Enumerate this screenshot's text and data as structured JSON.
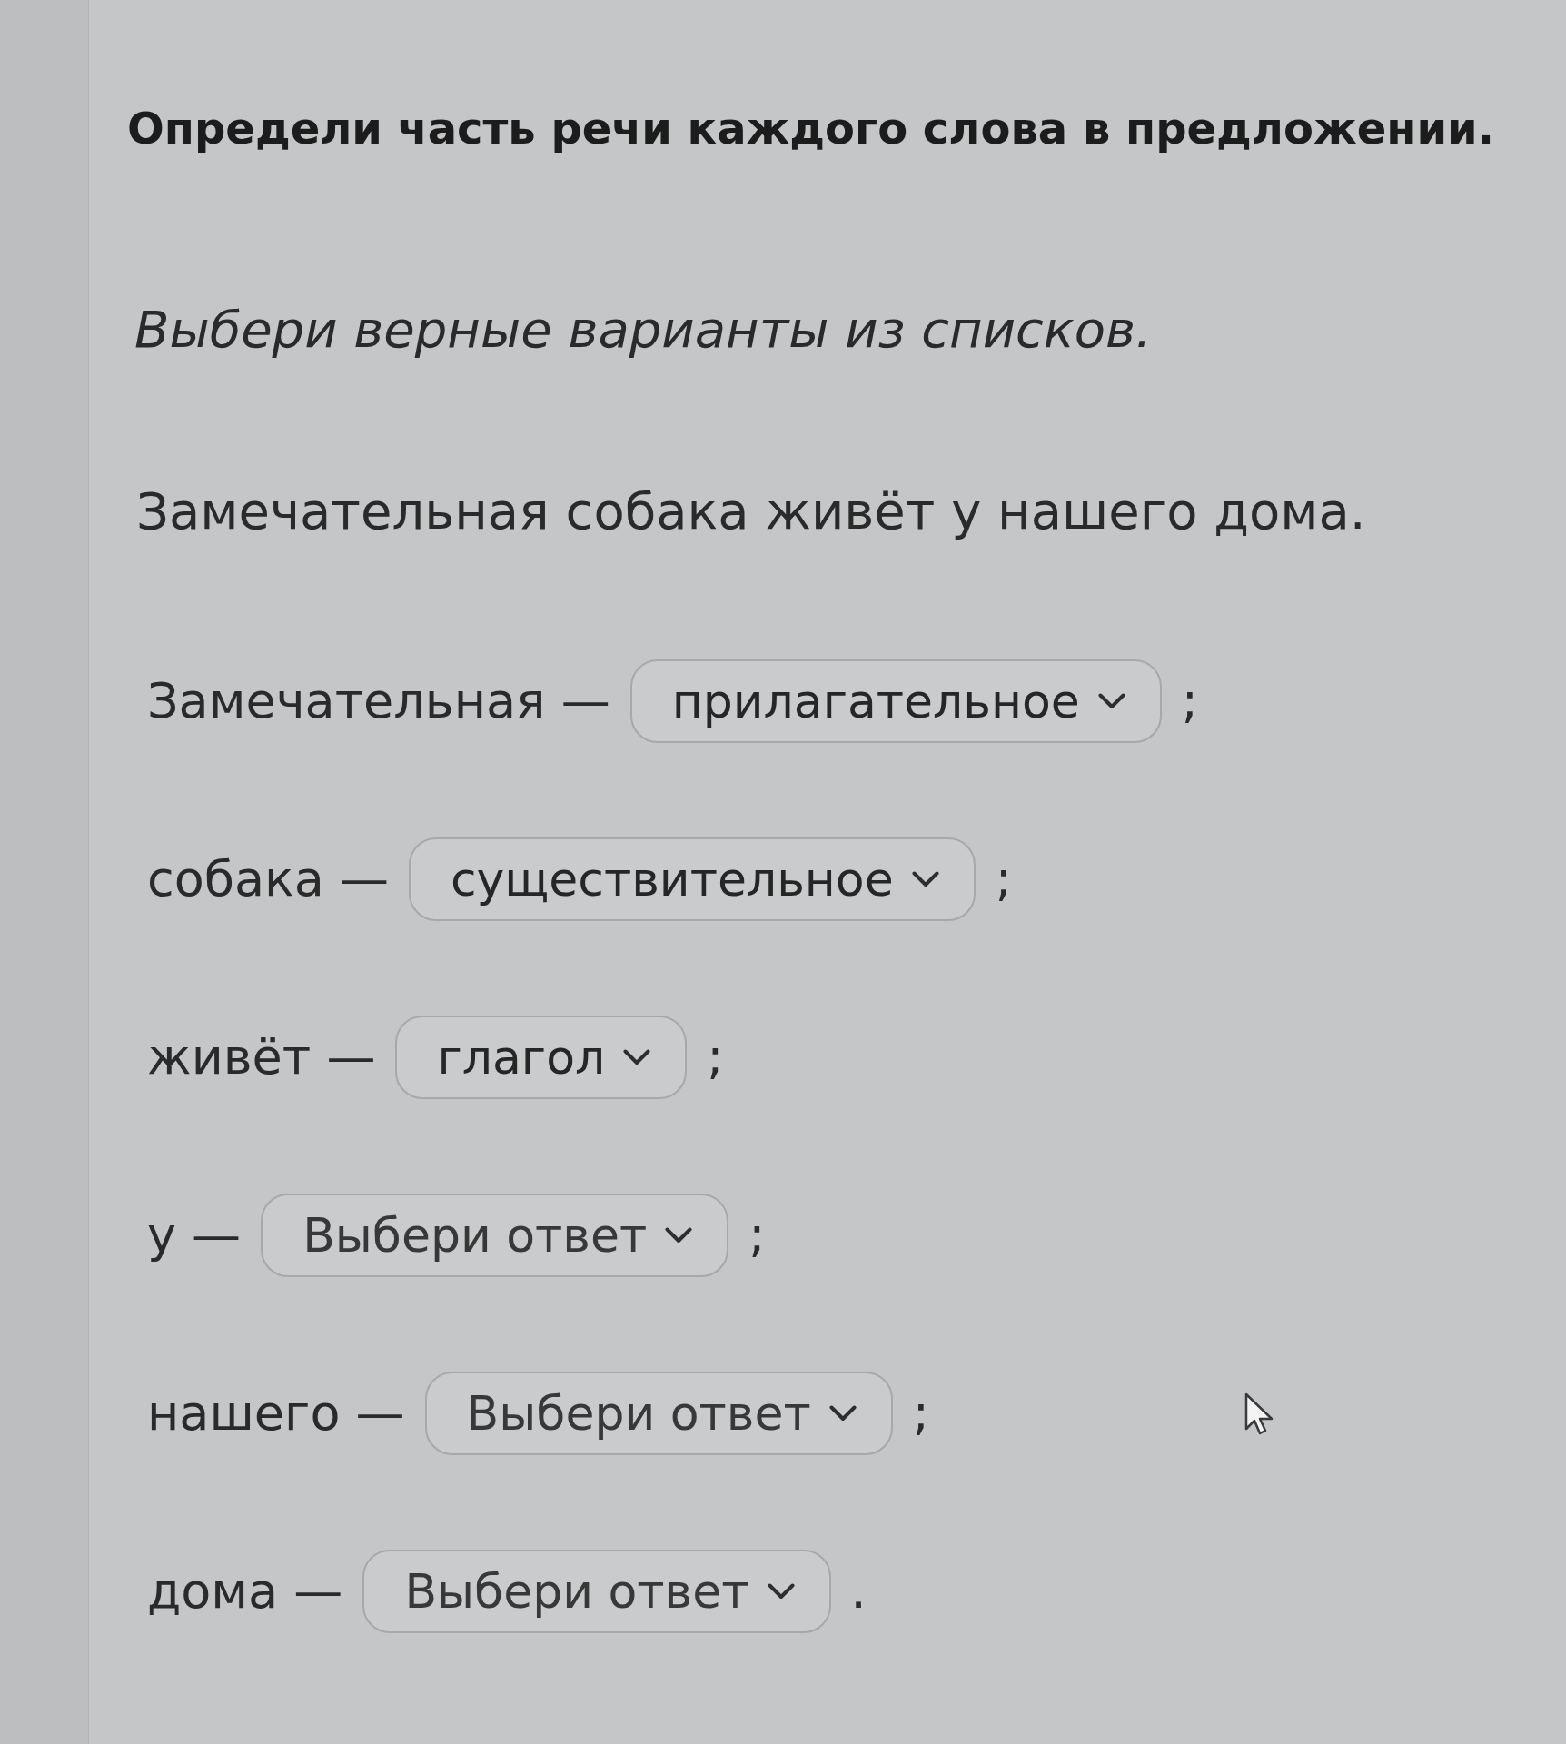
{
  "task": {
    "title": "Определи часть речи каждого слова в предложении.",
    "instruction": "Выбери верные варианты из списков.",
    "sentence": "Замечательная собака живёт у нашего дома."
  },
  "answers": [
    {
      "word": "Замечательная —",
      "value": "прилагательное",
      "suffix": ";"
    },
    {
      "word": "собака —",
      "value": "существительное",
      "suffix": ";"
    },
    {
      "word": "живёт —",
      "value": "глагол",
      "suffix": ";"
    },
    {
      "word": "у —",
      "placeholder": "Выбери ответ",
      "suffix": ";"
    },
    {
      "word": "нашего —",
      "placeholder": "Выбери ответ",
      "suffix": ";"
    },
    {
      "word": "дома —",
      "placeholder": "Выбери ответ",
      "suffix": "."
    }
  ]
}
